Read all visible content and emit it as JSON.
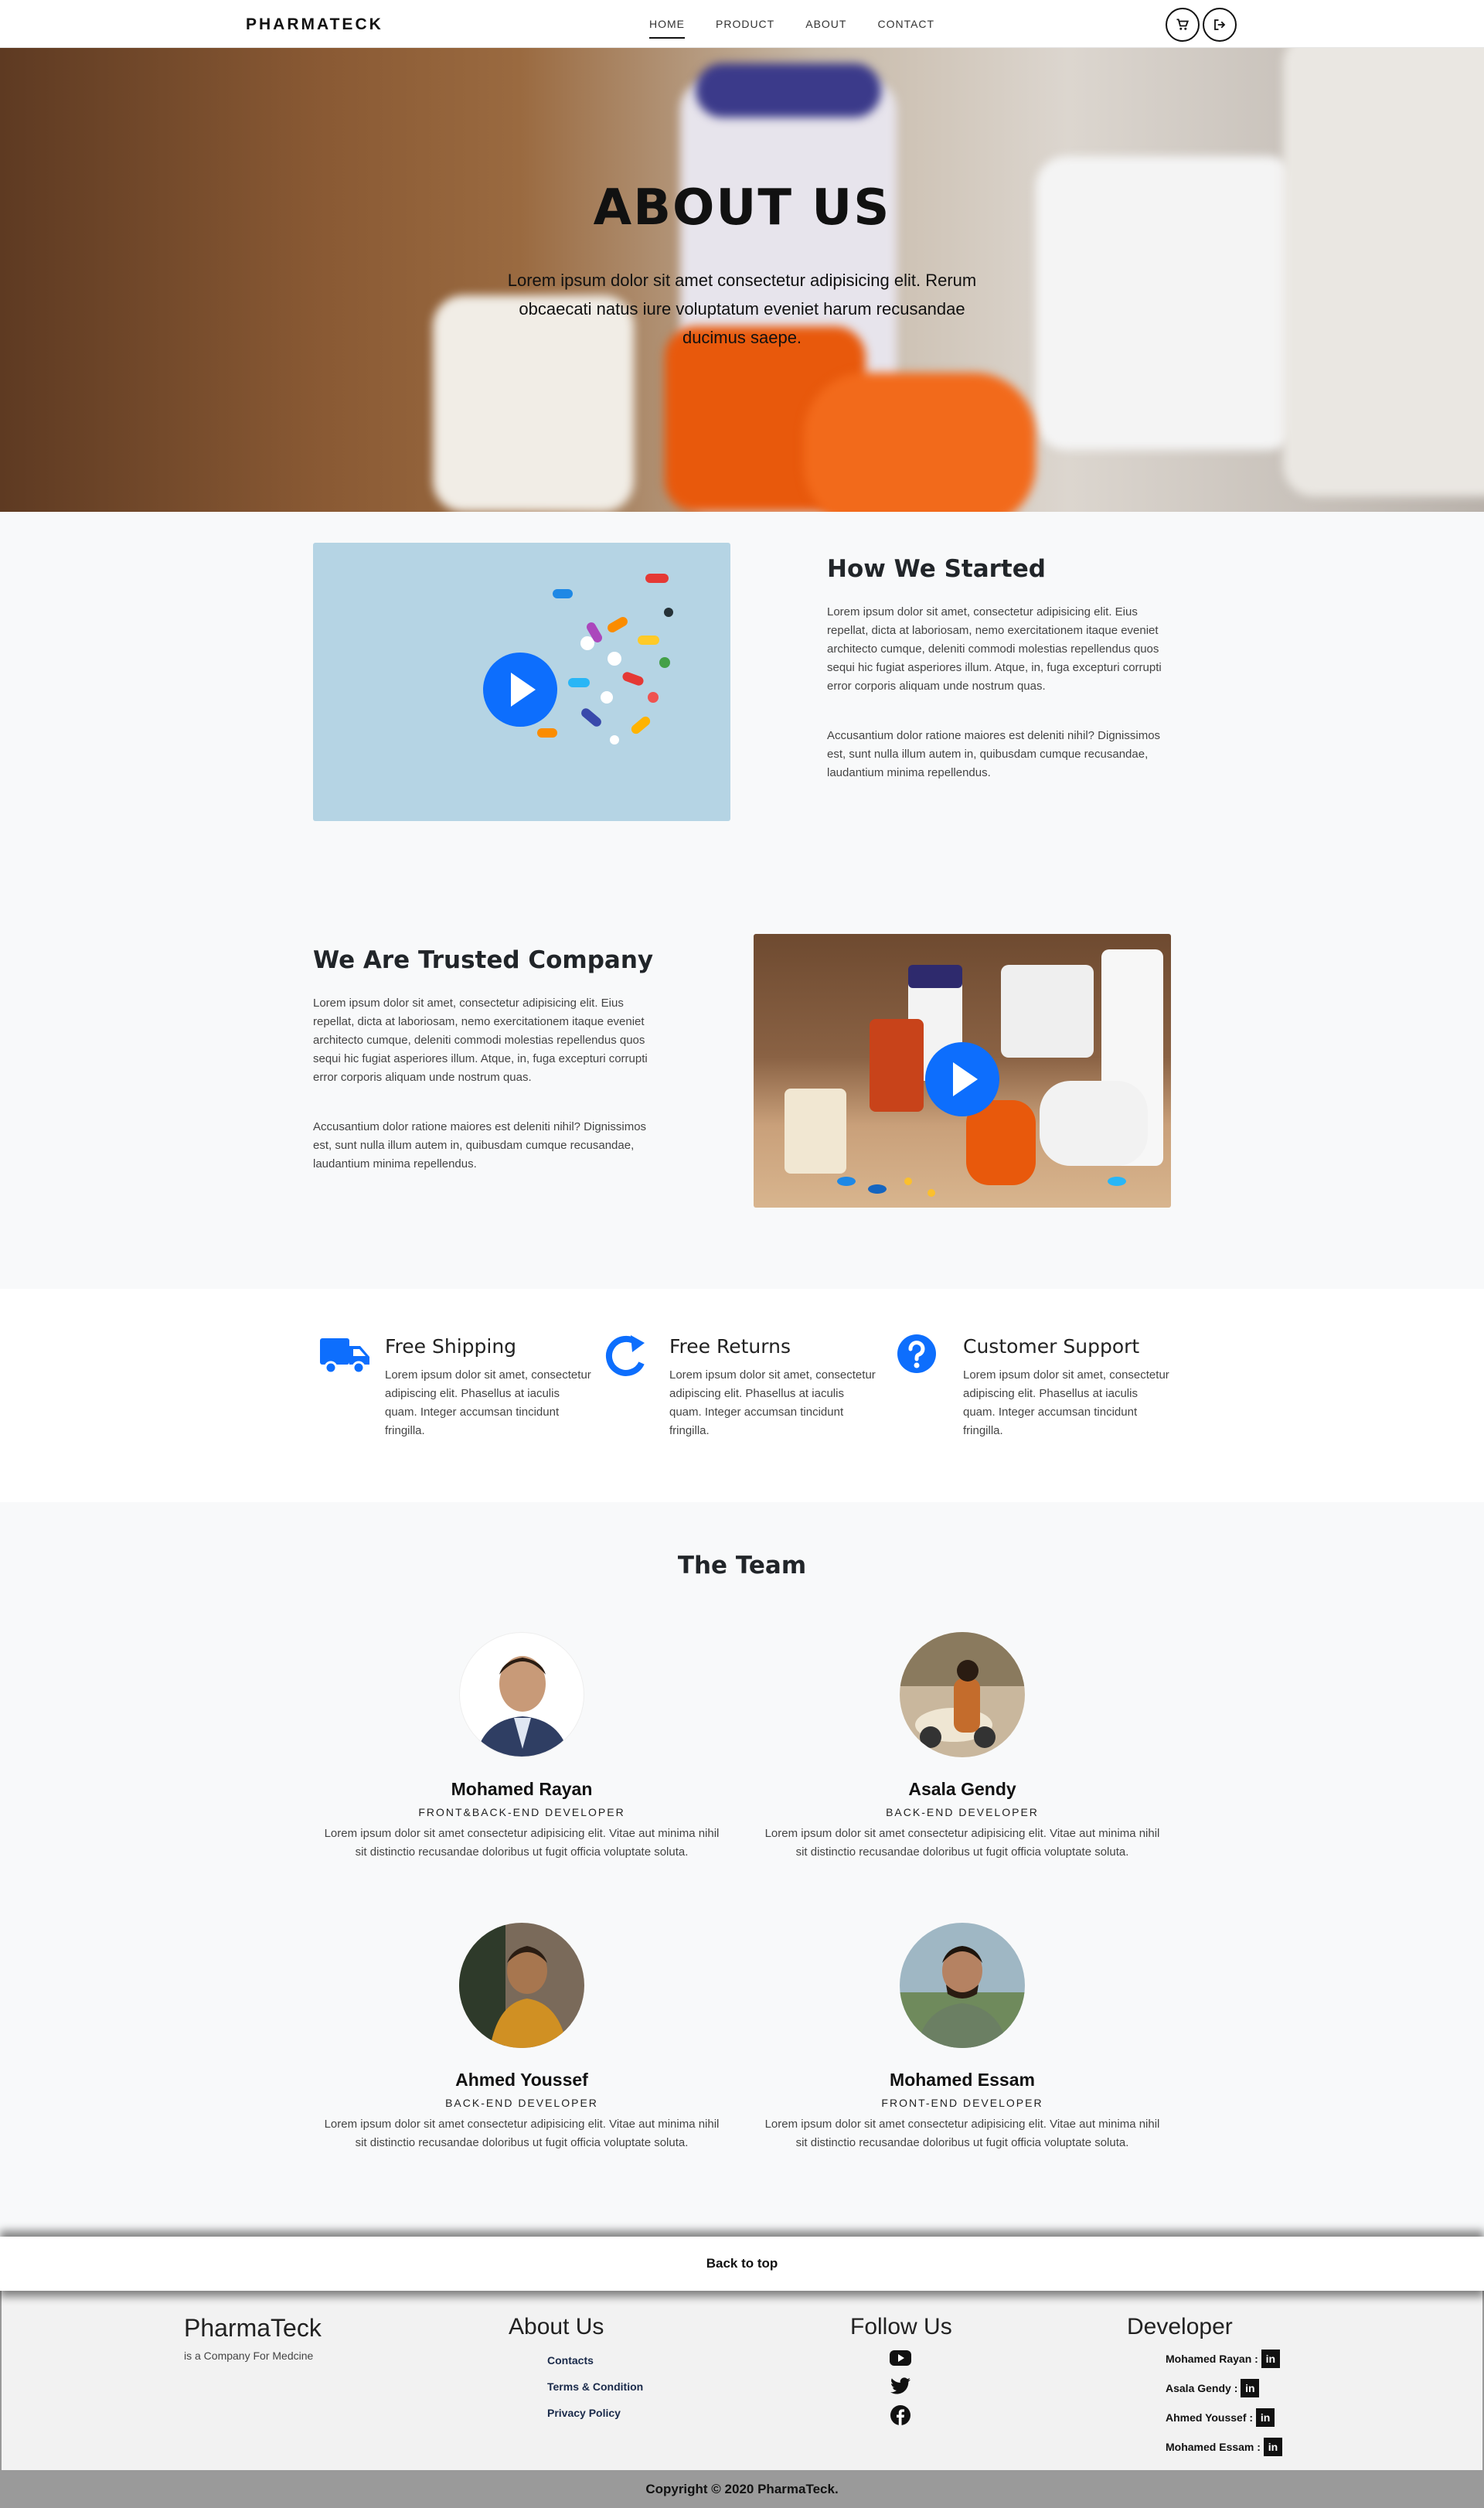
{
  "nav": {
    "brand": "PHARMATECK",
    "links": [
      "HOME",
      "PRODUCT",
      "ABOUT",
      "CONTACT"
    ]
  },
  "hero": {
    "title": "ABOUT US",
    "text": "Lorem ipsum dolor sit amet consectetur adipisicing elit. Rerum obcaecati natus iure voluptatum eveniet harum recusandae ducimus saepe."
  },
  "started": {
    "title": "How We Started",
    "p1": "Lorem ipsum dolor sit amet, consectetur adipisicing elit. Eius repellat, dicta at laboriosam, nemo exercitationem itaque eveniet architecto cumque, deleniti commodi molestias repellendus quos sequi hic fugiat asperiores illum. Atque, in, fuga excepturi corrupti error corporis aliquam unde nostrum quas.",
    "p2": "Accusantium dolor ratione maiores est deleniti nihil? Dignissimos est, sunt nulla illum autem in, quibusdam cumque recusandae, laudantium minima repellendus."
  },
  "trusted": {
    "title": "We Are Trusted Company",
    "p1": "Lorem ipsum dolor sit amet, consectetur adipisicing elit. Eius repellat, dicta at laboriosam, nemo exercitationem itaque eveniet architecto cumque, deleniti commodi molestias repellendus quos sequi hic fugiat asperiores illum. Atque, in, fuga excepturi corrupti error corporis aliquam unde nostrum quas.",
    "p2": "Accusantium dolor ratione maiores est deleniti nihil? Dignissimos est, sunt nulla illum autem in, quibusdam cumque recusandae, laudantium minima repellendus."
  },
  "features": [
    {
      "title": "Free Shipping",
      "text": "Lorem ipsum dolor sit amet, consectetur adipiscing elit. Phasellus at iaculis quam. Integer accumsan tincidunt fringilla.",
      "icon": "truck-icon"
    },
    {
      "title": "Free Returns",
      "text": "Lorem ipsum dolor sit amet, consectetur adipiscing elit. Phasellus at iaculis quam. Integer accumsan tincidunt fringilla.",
      "icon": "redo-icon"
    },
    {
      "title": "Customer Support",
      "text": "Lorem ipsum dolor sit amet, consectetur adipiscing elit. Phasellus at iaculis quam. Integer accumsan tincidunt fringilla.",
      "icon": "question-circle-icon"
    }
  ],
  "team": {
    "title": "The Team",
    "members": [
      {
        "name": "Mohamed Rayan",
        "role": "FRONT&BACK-END DEVELOPER",
        "desc": "Lorem ipsum dolor sit amet consectetur adipisicing elit. Vitae aut minima nihil sit distinctio recusandae doloribus ut fugit officia voluptate soluta."
      },
      {
        "name": "Asala Gendy",
        "role": "BACK-END DEVELOPER",
        "desc": "Lorem ipsum dolor sit amet consectetur adipisicing elit. Vitae aut minima nihil sit distinctio recusandae doloribus ut fugit officia voluptate soluta."
      },
      {
        "name": "Ahmed Youssef",
        "role": "BACK-END DEVELOPER",
        "desc": "Lorem ipsum dolor sit amet consectetur adipisicing elit. Vitae aut minima nihil sit distinctio recusandae doloribus ut fugit officia voluptate soluta."
      },
      {
        "name": "Mohamed Essam",
        "role": "FRONT-END DEVELOPER",
        "desc": "Lorem ipsum dolor sit amet consectetur adipisicing elit. Vitae aut minima nihil sit distinctio recusandae doloribus ut fugit officia voluptate soluta."
      }
    ]
  },
  "back_to_top": "Back to top",
  "footer": {
    "brand": "PharmaTeck",
    "tagline": "is a Company For Medcine",
    "about_title": "About Us",
    "about_links": [
      "Contacts",
      "Terms & Condition",
      "Privacy Policy"
    ],
    "follow_title": "Follow Us",
    "social_icons": [
      "youtube-icon",
      "twitter-icon",
      "facebook-icon"
    ],
    "developer_title": "Developer",
    "developers": [
      "Mohamed Rayan :",
      "Asala Gendy :",
      "Ahmed Youssef :",
      "Mohamed Essam :"
    ],
    "copyright": "Copyright © 2020 PharmaTeck."
  },
  "colors": {
    "accent": "#0d6efd",
    "dark": "#111111",
    "light_bg": "#f8f9fa",
    "copyright_bg": "#9a9a9a"
  }
}
